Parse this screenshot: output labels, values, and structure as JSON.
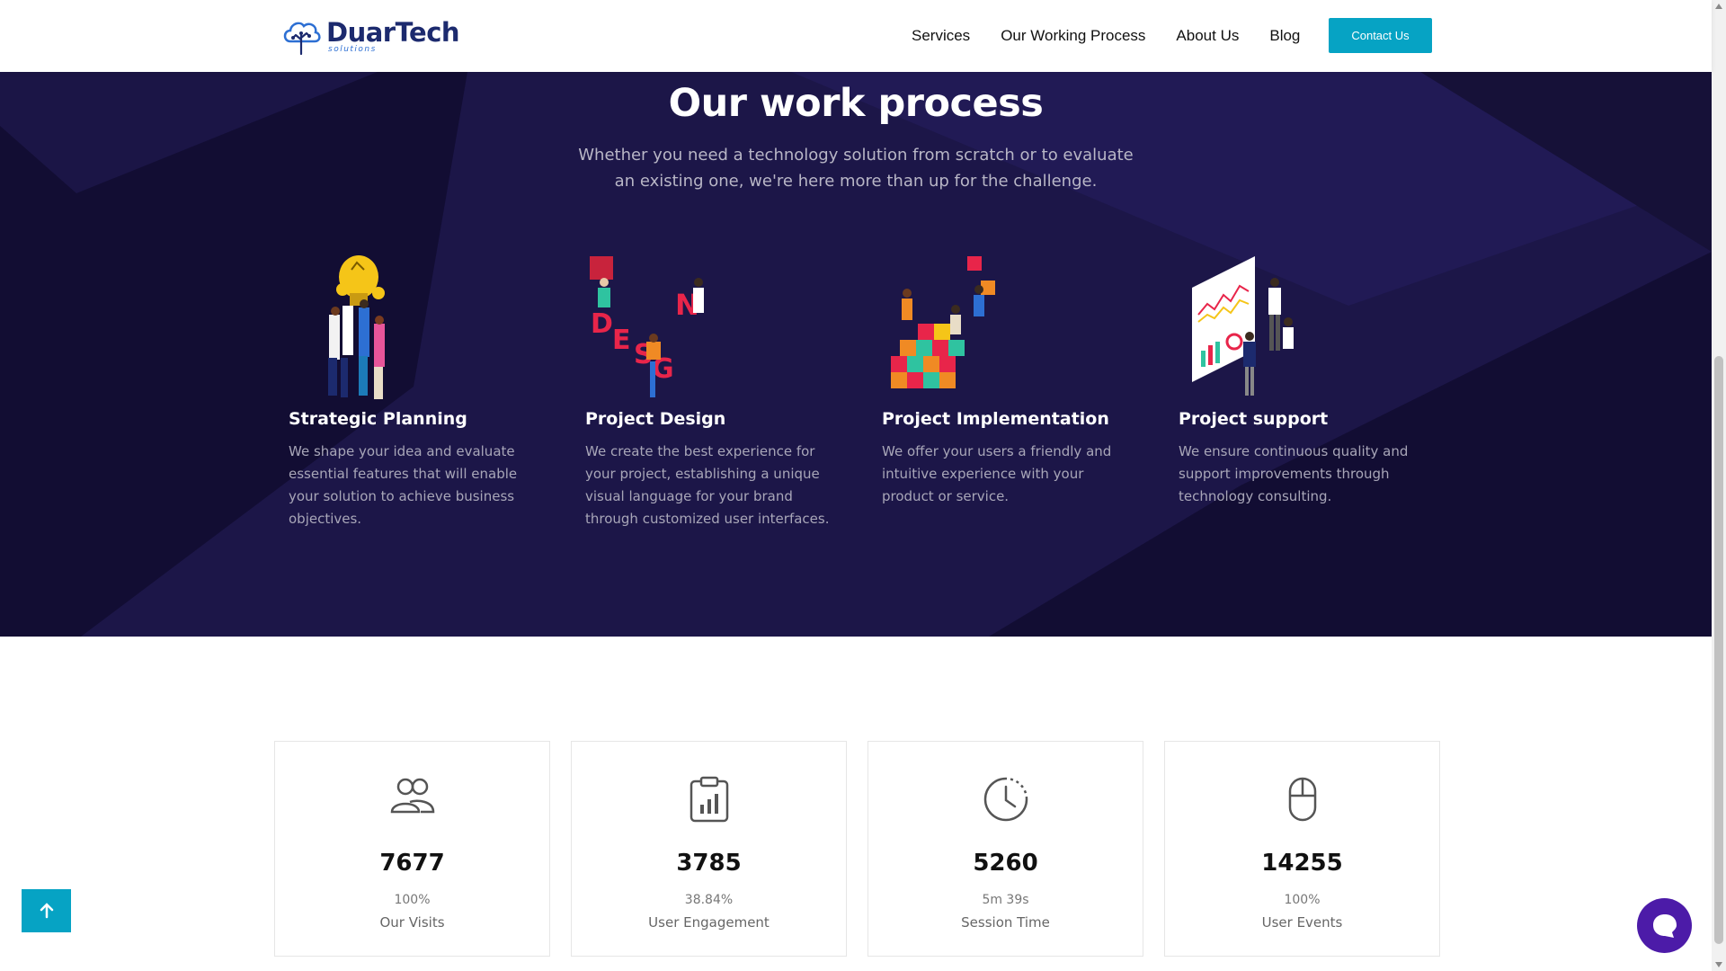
{
  "header": {
    "brand": "DuarTech",
    "brand_sub": "solutions",
    "logo_icon": "cloud-tree-logo",
    "nav": [
      "Services",
      "Our Working Process",
      "About Us",
      "Blog"
    ],
    "contact_label": "Contact Us",
    "accent": "#06a3c4"
  },
  "process": {
    "title": "Our work process",
    "subtitle": "Whether you need a technology solution from scratch or to evaluate an existing one, we're here more than up for the challenge.",
    "background": "#120d33",
    "steps": [
      {
        "title": "Strategic Planning",
        "text": "We shape your idea and evaluate essential features that will enable your solution to achieve business objectives.",
        "illustration": "people-lightbulb-illustration"
      },
      {
        "title": "Project Design",
        "text": "We create the best experience for your project, establishing a unique visual language for your brand through customized user interfaces.",
        "illustration": "design-letters-illustration"
      },
      {
        "title": "Project Implementation",
        "text": "We offer your users a friendly and intuitive experience with your product or service.",
        "illustration": "building-blocks-illustration"
      },
      {
        "title": "Project support",
        "text": "We ensure continuous quality and support improvements through technology consulting.",
        "illustration": "dashboard-charts-illustration"
      }
    ]
  },
  "stats": [
    {
      "value": "7677",
      "percent": "100%",
      "label": "Our Visits",
      "icon": "users-icon"
    },
    {
      "value": "3785",
      "percent": "38.84%",
      "label": "User Engagement",
      "icon": "clipboard-chart-icon"
    },
    {
      "value": "5260",
      "percent": "5m 39s",
      "label": "Session Time",
      "icon": "clock-icon"
    },
    {
      "value": "14255",
      "percent": "100%",
      "label": "User Events",
      "icon": "mouse-icon"
    }
  ],
  "floating": {
    "scroll_top_icon": "arrow-up-icon",
    "chat_icon": "chat-bubble-icon",
    "chat_color": "#4c1ba8"
  }
}
